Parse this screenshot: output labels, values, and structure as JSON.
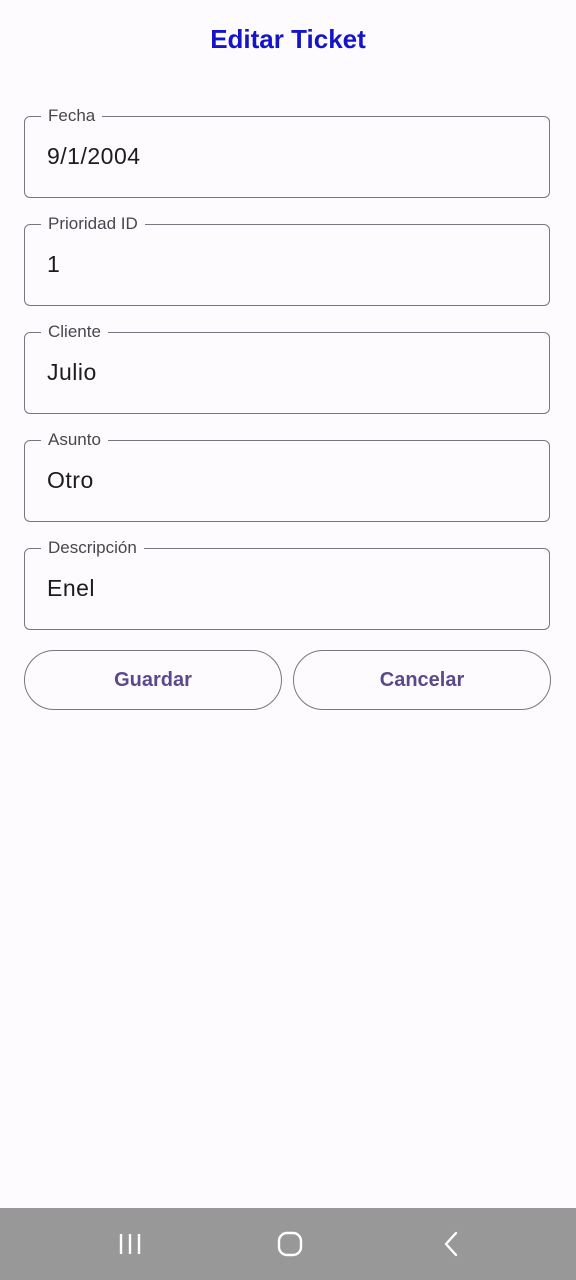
{
  "header": {
    "title": "Editar Ticket"
  },
  "form": {
    "fields": [
      {
        "label": "Fecha",
        "value": "9/1/2004"
      },
      {
        "label": "Prioridad ID",
        "value": "1"
      },
      {
        "label": "Cliente",
        "value": "Julio"
      },
      {
        "label": "Asunto",
        "value": "Otro"
      },
      {
        "label": "Descripción",
        "value": "Enel"
      }
    ],
    "save_label": "Guardar",
    "cancel_label": "Cancelar"
  },
  "nav_bar": {
    "icons": [
      "recent-apps-icon",
      "home-icon",
      "back-icon"
    ]
  },
  "colors": {
    "title": "#1414c8",
    "button_text": "#5a4a8c",
    "outline": "#7a7580",
    "background": "#fefbfe",
    "nav_bar": "#989898"
  }
}
